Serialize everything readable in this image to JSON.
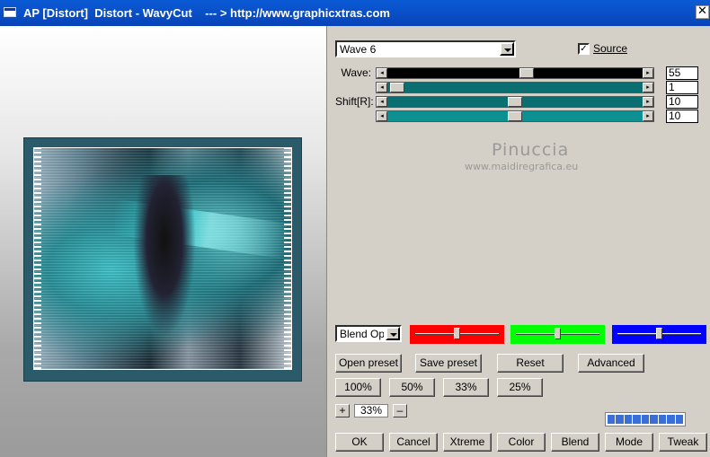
{
  "titlebar": {
    "title": "AP [Distort]  Distort - WavyCut    --- > http://www.graphicxtras.com",
    "close_glyph": "✕"
  },
  "preset": {
    "value": "Wave 6"
  },
  "source": {
    "label": "Source",
    "checked": true,
    "check_glyph": "✓"
  },
  "sliders": [
    {
      "label": "Wave:",
      "value": "55",
      "fill": 0.55,
      "color": "#000000"
    },
    {
      "label": "",
      "value": "1",
      "fill": 0.01,
      "color": "#0b6e71"
    },
    {
      "label": "Shift[R]:",
      "value": "10",
      "fill": 0.5,
      "color": "#0b6e71"
    },
    {
      "label": "",
      "value": "10",
      "fill": 0.5,
      "color": "#0e8f92"
    }
  ],
  "arrows": {
    "left": "◂",
    "right": "▸"
  },
  "watermark": {
    "name": "Pinuccia",
    "url": "www.maidiregrafica.eu"
  },
  "blend": {
    "value": "Blend Options"
  },
  "color_sliders": [
    {
      "color": "#ff0000",
      "fill": 0.5
    },
    {
      "color": "#00ff00",
      "fill": 0.5
    },
    {
      "color": "#0000ff",
      "fill": 0.5
    }
  ],
  "buttons": {
    "open_preset": "Open preset",
    "save_preset": "Save preset",
    "reset": "Reset",
    "advanced": "Advanced",
    "zoom_100": "100%",
    "zoom_50": "50%",
    "zoom_33": "33%",
    "zoom_25": "25%",
    "zoom_plus": "+",
    "zoom_minus": "–",
    "ok": "OK",
    "cancel": "Cancel",
    "xtreme": "Xtreme",
    "color": "Color",
    "blend": "Blend",
    "mode": "Mode",
    "tweak": "Tweak"
  },
  "zoom": {
    "value": "33%"
  },
  "progress": {
    "fraction": 1.0,
    "segments": 9
  }
}
